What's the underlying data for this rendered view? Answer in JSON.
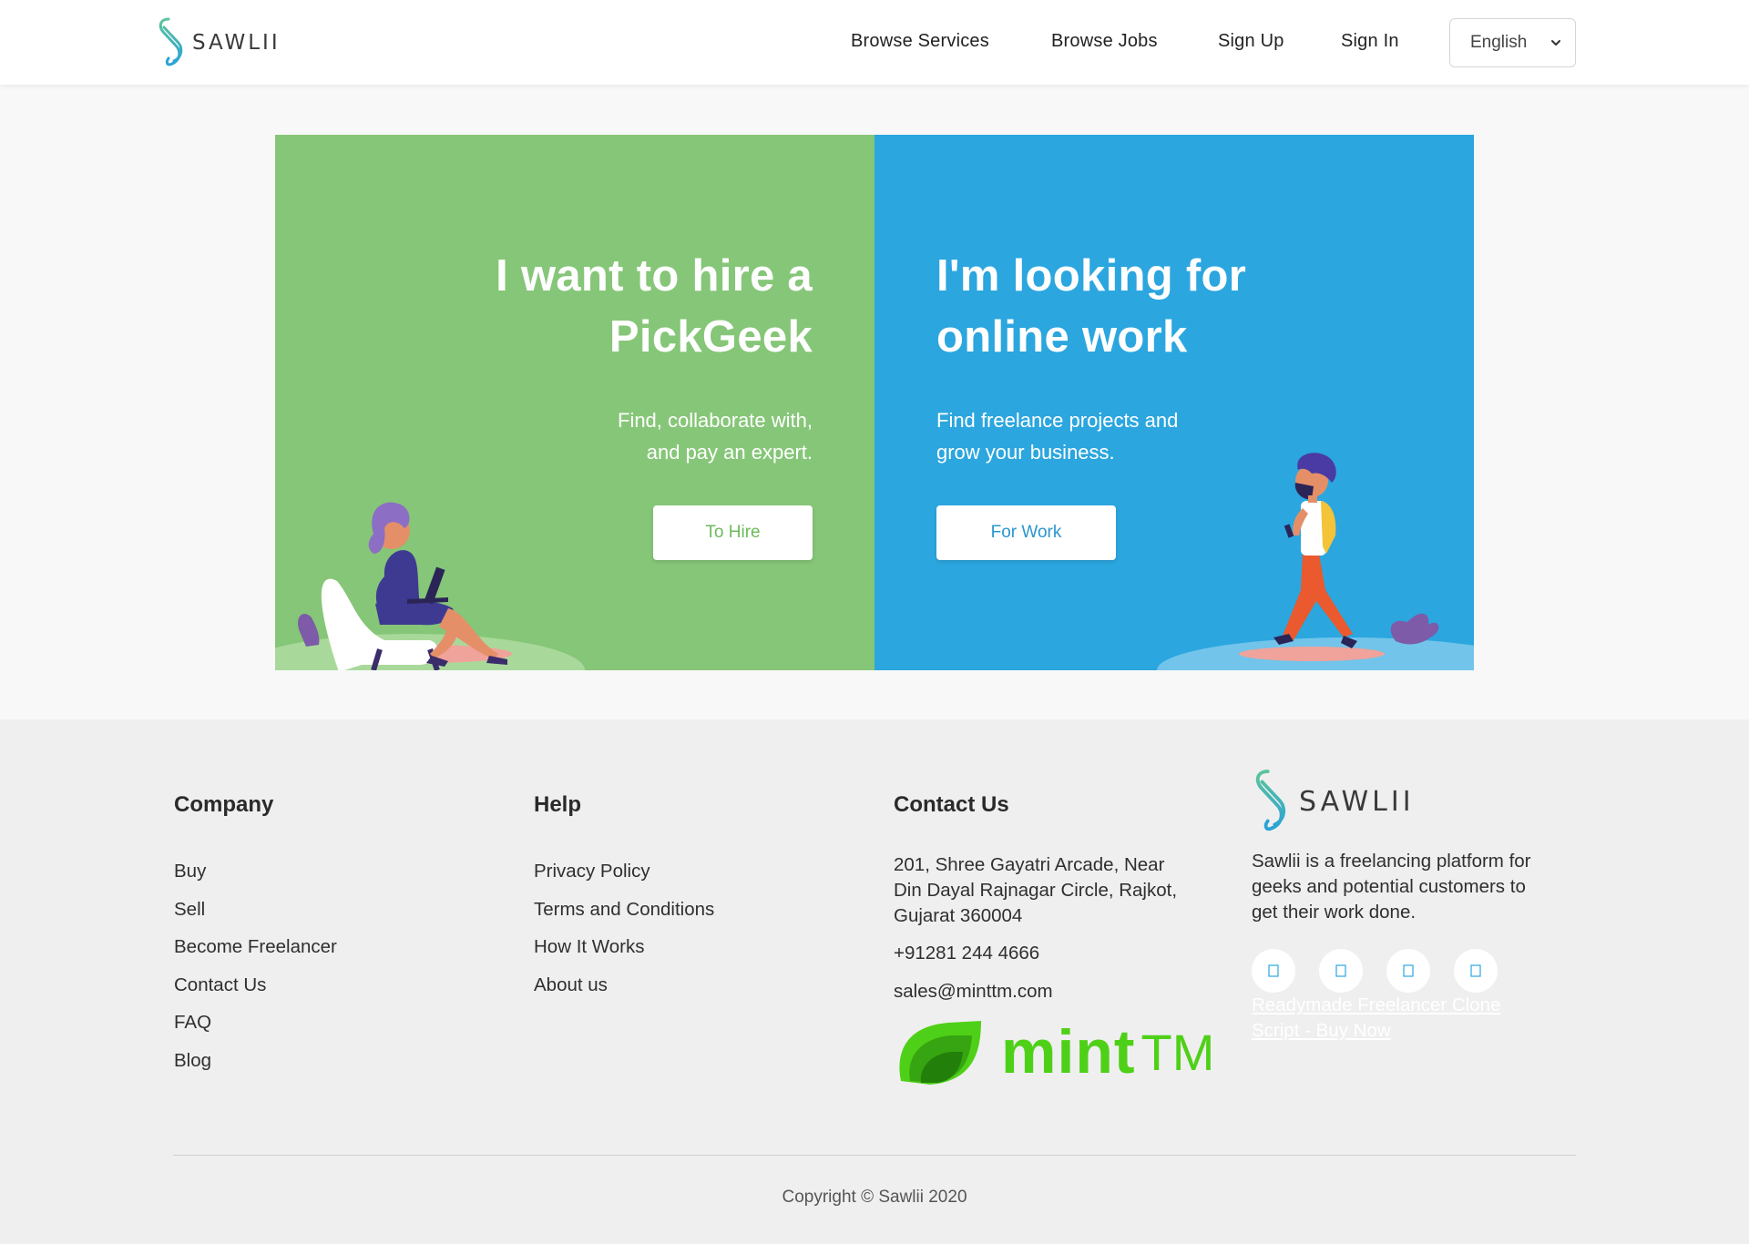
{
  "header": {
    "logo_text": "SAWLII",
    "nav": [
      "Browse Services",
      "Browse Jobs",
      "Sign Up",
      "Sign In"
    ],
    "language": "English"
  },
  "hero": {
    "hire": {
      "title_line1": "I want to hire a",
      "title_line2": "PickGeek",
      "desc_line1": "Find, collaborate with,",
      "desc_line2": "and pay an expert.",
      "button": "To Hire"
    },
    "work": {
      "title_line1": "I'm looking for",
      "title_line2": "online work",
      "desc_line1": "Find freelance projects and",
      "desc_line2": "grow your business.",
      "button": "For Work"
    }
  },
  "footer": {
    "company": {
      "heading": "Company",
      "links": [
        "Buy",
        "Sell",
        "Become Freelancer",
        "Contact Us",
        "FAQ",
        "Blog"
      ]
    },
    "help": {
      "heading": "Help",
      "links": [
        "Privacy Policy",
        "Terms and Conditions",
        "How It Works",
        "About us"
      ]
    },
    "contact": {
      "heading": "Contact Us",
      "address_line1": "201, Shree Gayatri Arcade, Near",
      "address_line2": "Din Dayal Rajnagar Circle, Rajkot,",
      "address_line3": "Gujarat 360004",
      "phone": "+91281 244 4666",
      "email": "sales@minttm.com",
      "partner_logo": "mint",
      "partner_logo_suffix": "TM"
    },
    "brand": {
      "logo_text": "SAWLII",
      "about_line1": "Sawlii is a freelancing platform for",
      "about_line2": "geeks and potential customers to",
      "about_line3": "get their work done.",
      "social_icons": [
        "social-icon-1",
        "social-icon-2",
        "social-icon-3",
        "social-icon-4"
      ],
      "clone_link_line1": "Readymade Freelancer Clone",
      "clone_link_line2": "Script - Buy Now"
    },
    "copyright": "Copyright © Sawlii 2020"
  },
  "colors": {
    "hire_panel": "#86c678",
    "work_panel": "#2ba6df",
    "mint_green": "#4fd018",
    "footer_bg": "#efefef"
  }
}
